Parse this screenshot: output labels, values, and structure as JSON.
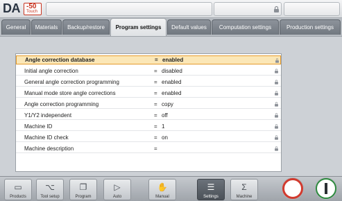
{
  "brand": {
    "logo_text": "DA",
    "model_number": "-50",
    "model_suffix": "Touch"
  },
  "tabs": [
    {
      "label": "General"
    },
    {
      "label": "Materials"
    },
    {
      "label": "Backup/restore"
    },
    {
      "label": "Program settings",
      "active": true
    },
    {
      "label": "Default values"
    },
    {
      "label": "Computation settings"
    },
    {
      "label": "Production settings"
    }
  ],
  "settings": [
    {
      "label": "Angle correction database",
      "value": "enabled",
      "selected": true
    },
    {
      "label": "Initial angle correction",
      "value": "disabled"
    },
    {
      "label": "General angle correction programming",
      "value": "enabled"
    },
    {
      "label": "Manual mode store angle corrections",
      "value": "enabled"
    },
    {
      "label": "Angle correction programming",
      "value": "copy"
    },
    {
      "label": "Y1/Y2 independent",
      "value": "off"
    },
    {
      "label": "Machine ID",
      "value": "1"
    },
    {
      "label": "Machine ID check",
      "value": "on"
    },
    {
      "label": "Machine description",
      "value": ""
    }
  ],
  "equals_sign": "=",
  "nav": [
    {
      "label": "Products",
      "icon": "folder-icon"
    },
    {
      "label": "Tool setup",
      "icon": "tool-icon"
    },
    {
      "label": "Program",
      "icon": "pages-icon"
    },
    {
      "label": "Auto",
      "icon": "play-icon"
    },
    {
      "label": "Manual",
      "icon": "hand-icon"
    },
    {
      "label": "Settings",
      "icon": "list-icon",
      "active": true
    },
    {
      "label": "Machine",
      "icon": "machine-icon"
    }
  ],
  "colors": {
    "accent_selected": "#e59a2c",
    "stop": "#d23a2e",
    "start": "#2d8a3e"
  }
}
